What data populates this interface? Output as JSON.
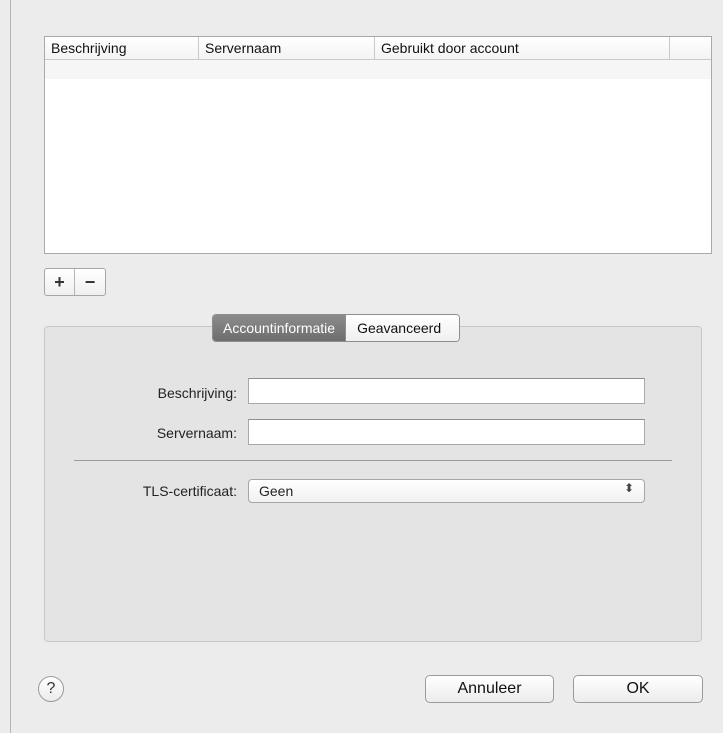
{
  "table": {
    "columns": [
      "Beschrijving",
      "Servernaam",
      "Gebruikt door account",
      ""
    ],
    "rows": []
  },
  "list_controls": {
    "add": "+",
    "remove": "−"
  },
  "tabs": [
    {
      "label": "Accountinformatie",
      "active": true
    },
    {
      "label": "Geavanceerd",
      "active": false
    }
  ],
  "form": {
    "description_label": "Beschrijving:",
    "description_value": "",
    "server_label": "Servernaam:",
    "server_value": "",
    "tls_label": "TLS-certificaat:",
    "tls_value": "Geen"
  },
  "buttons": {
    "help": "?",
    "cancel": "Annuleer",
    "ok": "OK"
  }
}
